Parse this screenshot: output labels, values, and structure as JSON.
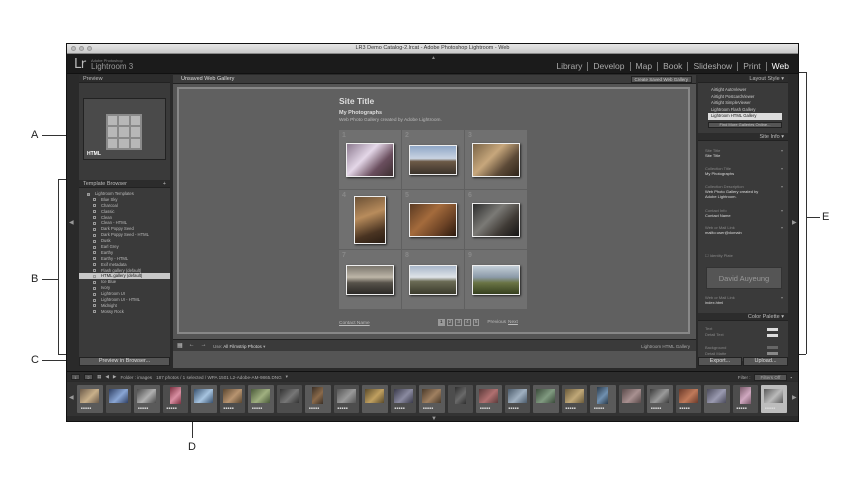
{
  "callouts": {
    "a": "A",
    "b": "B",
    "c": "C",
    "d": "D",
    "e": "E"
  },
  "window": {
    "title": "LR3 Demo Catalog-2.lrcat - Adobe Photoshop Lightroom - Web"
  },
  "identity": {
    "logo": "Lr",
    "sub": "Adobe Photoshop",
    "name": "Lightroom 3"
  },
  "modules": [
    "Library",
    "Develop",
    "Map",
    "Book",
    "Slideshow",
    "Print",
    "Web"
  ],
  "left_panel": {
    "preview_title": "Preview",
    "preview_label": "HTML",
    "template_browser_title": "Template Browser",
    "templates": [
      "Lightroom Templates",
      "Blue Sky",
      "Charcoal",
      "Classic",
      "Clean",
      "Clean - HTML",
      "Dark Poppy Seed",
      "Dark Poppy Seed - HTML",
      "Dusk",
      "Earl Grey",
      "Earthy",
      "Earthy - HTML",
      "Exif metadata",
      "Flash gallery (default)",
      "HTML gallery (default)",
      "Ice Blue",
      "Ivory",
      "Lightroom UI",
      "Lightroom UI - HTML",
      "Midnight",
      "Mossy Rock"
    ],
    "preview_in_browser": "Preview in Browser..."
  },
  "center": {
    "gallery_name": "Unsaved Web Gallery",
    "create_saved": "Create Saved Web Gallery",
    "site_title": "Site Title",
    "collection_title": "My Photographs",
    "description": "Web Photo Gallery created by Adobe Lightroom.",
    "cell_numbers": [
      "1",
      "2",
      "3",
      "4",
      "5",
      "6",
      "7",
      "8",
      "9"
    ],
    "contact": "Contact Name",
    "pages": [
      "1",
      "2",
      "3",
      "4",
      "5"
    ],
    "previous": "Previous",
    "next": "Next",
    "use_label": "Use:",
    "use_value": "All Filmstrip Photos",
    "engine": "Lightroom HTML Gallery"
  },
  "right_panel": {
    "layout_style_title": "Layout Style",
    "layout_styles": [
      "Airtight AutoViewer",
      "Airtight PostcardViewer",
      "Airtight SimpleViewer",
      "Lightroom Flash Gallery",
      "Lightroom HTML Gallery"
    ],
    "find_more": "Find More Galleries Online...",
    "site_info_title": "Site Info",
    "fields": [
      {
        "label": "Site Title",
        "value": "Site Title"
      },
      {
        "label": "Collection Title",
        "value": "My Photographs"
      },
      {
        "label": "Collection Description",
        "value": "Web Photo Gallery created by Adobe Lightroom."
      },
      {
        "label": "Contact Info",
        "value": "Contact Name"
      },
      {
        "label": "Web or Mail Link",
        "value": "mailto:user@domain"
      }
    ],
    "identity_plate_label": "Identity Plate",
    "identity_plate_text": "David Auyeung",
    "web_link_label": "Web or Mail Link",
    "web_link_value": "index.html",
    "color_palette_title": "Color Palette",
    "palette": [
      {
        "label": "Text"
      },
      {
        "label": "Detail Text"
      },
      {
        "label": "Background"
      },
      {
        "label": "Detail Matte"
      }
    ],
    "export": "Export...",
    "upload": "Upload..."
  },
  "filmstrip": {
    "screens": [
      "1",
      "2"
    ],
    "path": "Folder : images",
    "count": "187 photos / 1 selected / WPA 1501 L2-Adobe-AM-9865.DNG",
    "filter_label": "Filter :",
    "filter_value": "Filters Off"
  },
  "colors": {
    "accent": "#ffffff",
    "panel": "#3a3a3a",
    "selected": "#c8c8c8"
  }
}
